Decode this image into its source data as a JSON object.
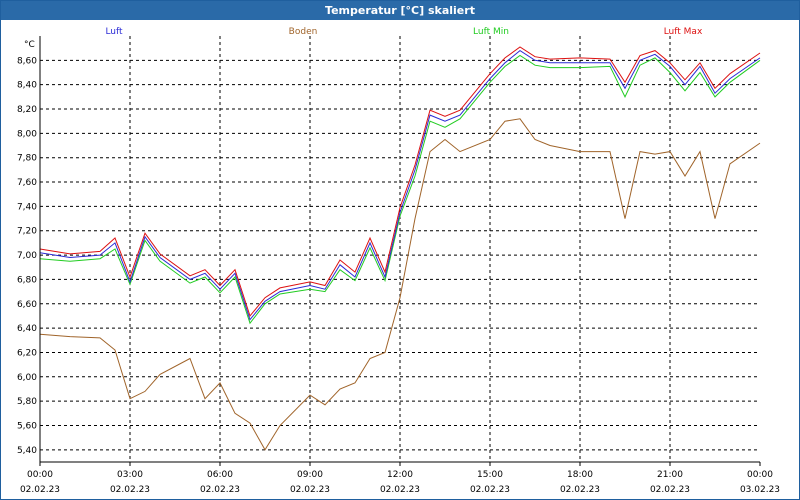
{
  "window": {
    "title": "Temperatur [°C] skaliert"
  },
  "colors": {
    "Luft": "#2b2bd6",
    "Boden": "#a0642a",
    "Luft Min": "#22cc22",
    "Luft Max": "#dd1111"
  },
  "chart_data": {
    "type": "line",
    "title": "Temperatur [°C] skaliert",
    "ylabel": "°C",
    "ylim": [
      5.3,
      8.8
    ],
    "xlim": [
      0,
      24
    ],
    "grid": true,
    "legend_position": "top",
    "yticks": [
      "5,40",
      "5,60",
      "5,80",
      "6,00",
      "6,20",
      "6,40",
      "6,60",
      "6,80",
      "7,00",
      "7,20",
      "7,40",
      "7,60",
      "7,80",
      "8,00",
      "8,20",
      "8,40",
      "8,60"
    ],
    "ytick_values": [
      5.4,
      5.6,
      5.8,
      6.0,
      6.2,
      6.4,
      6.6,
      6.8,
      7.0,
      7.2,
      7.4,
      7.6,
      7.8,
      8.0,
      8.2,
      8.4,
      8.6
    ],
    "xticks": [
      {
        "time": "00:00",
        "date": "02.02.23",
        "x": 0
      },
      {
        "time": "03:00",
        "date": "02.02.23",
        "x": 3
      },
      {
        "time": "06:00",
        "date": "02.02.23",
        "x": 6
      },
      {
        "time": "09:00",
        "date": "02.02.23",
        "x": 9
      },
      {
        "time": "12:00",
        "date": "02.02.23",
        "x": 12
      },
      {
        "time": "15:00",
        "date": "02.02.23",
        "x": 15
      },
      {
        "time": "18:00",
        "date": "02.02.23",
        "x": 18
      },
      {
        "time": "21:00",
        "date": "02.02.23",
        "x": 21
      },
      {
        "time": "00:00",
        "date": "03.02.23",
        "x": 24
      }
    ],
    "x": [
      0,
      1,
      2,
      2.5,
      3,
      3.5,
      4,
      5,
      5.5,
      6,
      6.5,
      7,
      7.5,
      8,
      9,
      9.5,
      10,
      10.5,
      11,
      11.5,
      12,
      12.5,
      13,
      13.5,
      14,
      15,
      15.5,
      16,
      16.5,
      17,
      18,
      19,
      19.5,
      20,
      20.5,
      21,
      21.5,
      22,
      22.5,
      23,
      24
    ],
    "series": [
      {
        "name": "Luft",
        "values": [
          7.02,
          6.98,
          7.0,
          7.1,
          6.78,
          7.15,
          6.98,
          6.8,
          6.85,
          6.72,
          6.85,
          6.47,
          6.62,
          6.7,
          6.75,
          6.72,
          6.92,
          6.82,
          7.1,
          6.82,
          7.35,
          7.7,
          8.15,
          8.1,
          8.15,
          8.45,
          8.58,
          8.68,
          8.6,
          8.58,
          8.58,
          8.58,
          8.37,
          8.6,
          8.65,
          8.55,
          8.4,
          8.55,
          8.33,
          8.45,
          8.62
        ]
      },
      {
        "name": "Boden",
        "values": [
          6.35,
          6.33,
          6.32,
          6.22,
          5.82,
          5.88,
          6.02,
          6.15,
          5.82,
          5.95,
          5.7,
          5.62,
          5.4,
          5.6,
          5.85,
          5.77,
          5.9,
          5.95,
          6.15,
          6.2,
          6.65,
          7.3,
          7.85,
          7.95,
          7.85,
          7.95,
          8.1,
          8.12,
          7.95,
          7.9,
          7.85,
          7.85,
          7.3,
          7.85,
          7.83,
          7.85,
          7.65,
          7.85,
          7.3,
          7.75,
          7.92
        ]
      },
      {
        "name": "Luft Min",
        "values": [
          6.97,
          6.95,
          6.97,
          7.05,
          6.76,
          7.12,
          6.95,
          6.77,
          6.82,
          6.69,
          6.82,
          6.44,
          6.6,
          6.68,
          6.72,
          6.7,
          6.88,
          6.79,
          7.06,
          6.79,
          7.32,
          7.65,
          8.1,
          8.05,
          8.12,
          8.42,
          8.55,
          8.64,
          8.56,
          8.54,
          8.54,
          8.55,
          8.3,
          8.56,
          8.62,
          8.5,
          8.35,
          8.5,
          8.3,
          8.42,
          8.6
        ]
      },
      {
        "name": "Luft Max",
        "values": [
          7.05,
          7.01,
          7.03,
          7.14,
          6.82,
          7.18,
          7.01,
          6.83,
          6.88,
          6.75,
          6.88,
          6.5,
          6.65,
          6.73,
          6.78,
          6.75,
          6.96,
          6.86,
          7.14,
          6.86,
          7.39,
          7.74,
          8.19,
          8.14,
          8.19,
          8.49,
          8.62,
          8.71,
          8.63,
          8.61,
          8.62,
          8.61,
          8.42,
          8.64,
          8.68,
          8.58,
          8.44,
          8.58,
          8.37,
          8.49,
          8.66
        ]
      }
    ]
  }
}
